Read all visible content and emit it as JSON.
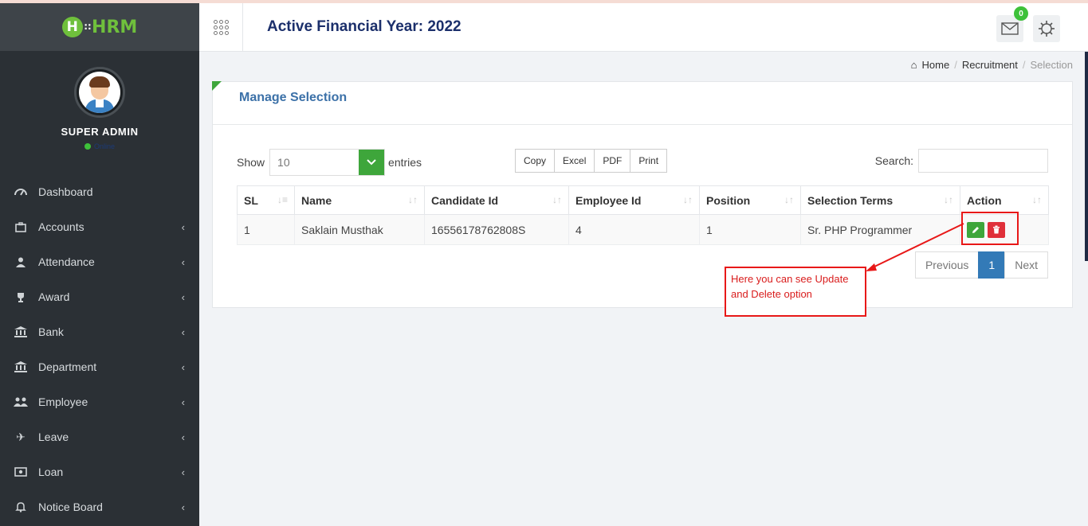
{
  "app": {
    "logo_text": "HRM",
    "logo_letter": "H",
    "accent": "#3ea63b"
  },
  "profile": {
    "name": "SUPER ADMIN",
    "status": "Online"
  },
  "sidebar": {
    "items": [
      {
        "label": "Dashboard",
        "icon": "dashboard-icon"
      },
      {
        "label": "Accounts",
        "icon": "briefcase-icon"
      },
      {
        "label": "Attendance",
        "icon": "user-icon"
      },
      {
        "label": "Award",
        "icon": "trophy-icon"
      },
      {
        "label": "Bank",
        "icon": "bank-icon"
      },
      {
        "label": "Department",
        "icon": "bank-icon"
      },
      {
        "label": "Employee",
        "icon": "users-icon"
      },
      {
        "label": "Leave",
        "icon": "plane-icon"
      },
      {
        "label": "Loan",
        "icon": "money-icon"
      },
      {
        "label": "Notice Board",
        "icon": "bell-icon"
      }
    ]
  },
  "header": {
    "financial_year": "Active Financial Year: 2022",
    "notification_count": "0"
  },
  "breadcrumb": {
    "home": "Home",
    "section": "Recruitment",
    "current": "Selection"
  },
  "panel": {
    "title": "Manage Selection"
  },
  "controls": {
    "show_label": "Show",
    "entries_value": "10",
    "entries_label": "entries",
    "export_buttons": [
      "Copy",
      "Excel",
      "PDF",
      "Print"
    ],
    "search_label": "Search:"
  },
  "table": {
    "headers": [
      "SL",
      "Name",
      "Candidate Id",
      "Employee Id",
      "Position",
      "Selection Terms",
      "Action"
    ],
    "rows": [
      {
        "sl": "1",
        "name": "Saklain Musthak",
        "candidate_id": "16556178762808S",
        "employee_id": "4",
        "position": "1",
        "selection_terms": "Sr. PHP Programmer"
      }
    ]
  },
  "pagination": {
    "previous": "Previous",
    "current": "1",
    "next": "Next"
  },
  "annotation": {
    "line1": "Here you can see Update",
    "line2": "and Delete option",
    "color": "#e81818"
  }
}
